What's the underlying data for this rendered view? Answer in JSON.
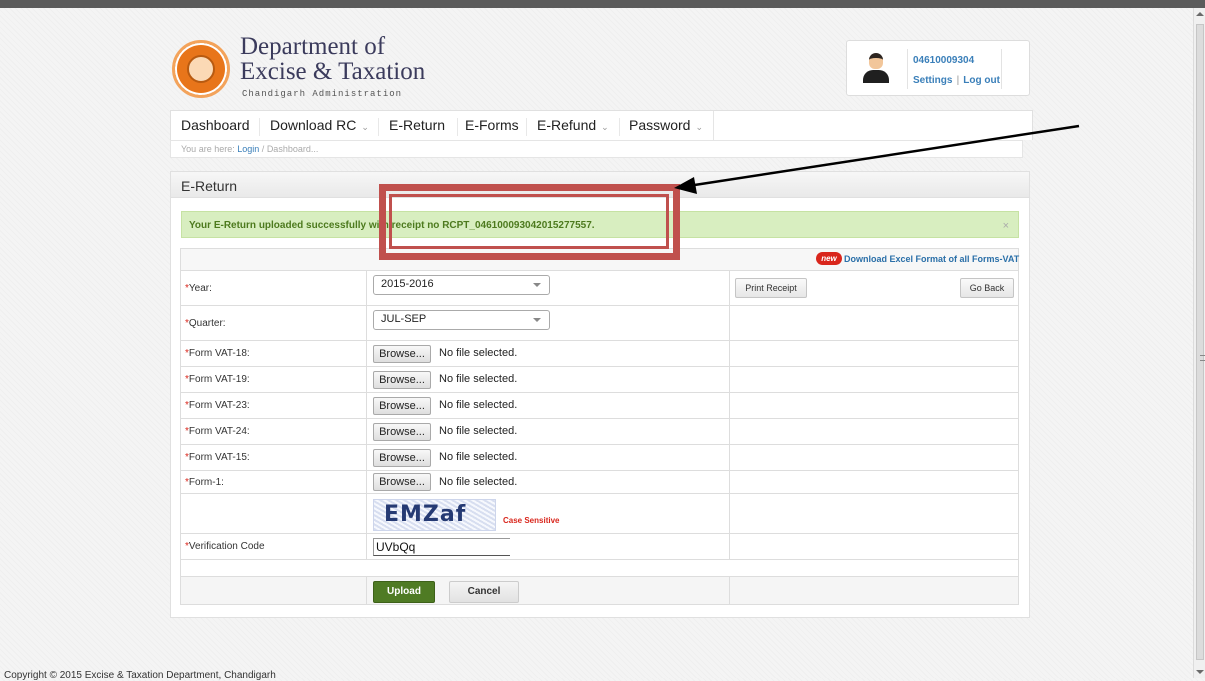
{
  "header": {
    "title": "Department of Excise & Taxation",
    "title_line1": "Department of",
    "title_line2": "Excise & Taxation",
    "subtitle": "Chandigarh Administration"
  },
  "user": {
    "id": "04610009304",
    "settings_label": "Settings",
    "logout_label": "Log out"
  },
  "nav": {
    "items": [
      {
        "label": "Dashboard",
        "has_dropdown": false
      },
      {
        "label": "Download RC",
        "has_dropdown": true
      },
      {
        "label": "E-Return",
        "has_dropdown": false
      },
      {
        "label": "E-Forms",
        "has_dropdown": false
      },
      {
        "label": "E-Refund",
        "has_dropdown": true
      },
      {
        "label": "Password",
        "has_dropdown": true
      }
    ],
    "caret": "⌄"
  },
  "breadcrumb": {
    "prefix": "You are here:",
    "login": "Login",
    "separator": "/",
    "current": "Dashboard..."
  },
  "panel": {
    "title": "E-Return"
  },
  "alert": {
    "message": "Your E-Return uploaded successfully with receipt no RCPT_04610009304201527755",
    "message_end": "7.",
    "close": "×"
  },
  "download": {
    "badge": "new",
    "link": "Download Excel Format of all Forms-VAT"
  },
  "form": {
    "year": {
      "label": "Year:",
      "value": "2015-2016"
    },
    "quarter": {
      "label": "Quarter:",
      "value": "JUL-SEP"
    },
    "print_receipt": "Print Receipt",
    "go_back": "Go Back",
    "files": [
      {
        "label": "Form VAT-18:",
        "button": "Browse...",
        "status": "No file selected."
      },
      {
        "label": "Form VAT-19:",
        "button": "Browse...",
        "status": "No file selected."
      },
      {
        "label": "Form VAT-23:",
        "button": "Browse...",
        "status": "No file selected."
      },
      {
        "label": "Form VAT-24:",
        "button": "Browse...",
        "status": "No file selected."
      },
      {
        "label": "Form VAT-15:",
        "button": "Browse...",
        "status": "No file selected."
      },
      {
        "label": "Form-1:",
        "button": "Browse...",
        "status": "No file selected."
      }
    ],
    "captcha": {
      "text": "EMZaf",
      "note": "Case Sensitive"
    },
    "verification": {
      "label": "Verification Code",
      "value": "UVbQq"
    },
    "required_mark": "*",
    "upload": "Upload",
    "cancel": "Cancel"
  },
  "footer": {
    "text": "Copyright © 2015 Excise & Taxation Department, Chandigarh"
  },
  "colors": {
    "highlight": "#c0504d",
    "alert_bg": "#d8eec0",
    "alert_text": "#4d7a1e",
    "link": "#3a7fb9",
    "upload_button": "#4f7b24"
  }
}
